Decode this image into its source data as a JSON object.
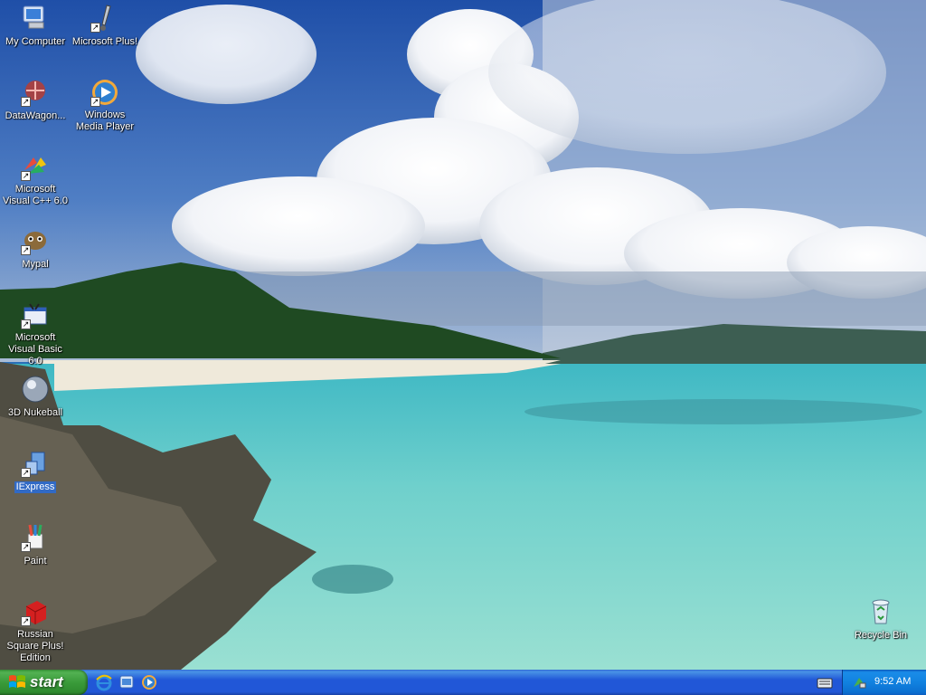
{
  "desktop": {
    "icons": [
      {
        "label": "My Computer"
      },
      {
        "label": "Microsoft Plus!"
      },
      {
        "label": "DataWagon..."
      },
      {
        "label": "Windows Media Player"
      },
      {
        "label": "Microsoft Visual C++ 6.0"
      },
      {
        "label": "Mypal"
      },
      {
        "label": "Microsoft Visual Basic 6.0"
      },
      {
        "label": "3D Nukeball"
      },
      {
        "label": "IExpress"
      },
      {
        "label": "Paint"
      },
      {
        "label": "Russian Square Plus! Edition"
      },
      {
        "label": "Recycle Bin"
      }
    ],
    "selected_icon": "IExpress"
  },
  "taskbar": {
    "start_label": "start",
    "clock": "9:52 AM",
    "colors": {
      "taskbar": "#2157d7",
      "start": "#3a9b3a",
      "tray": "#1182e0"
    }
  }
}
